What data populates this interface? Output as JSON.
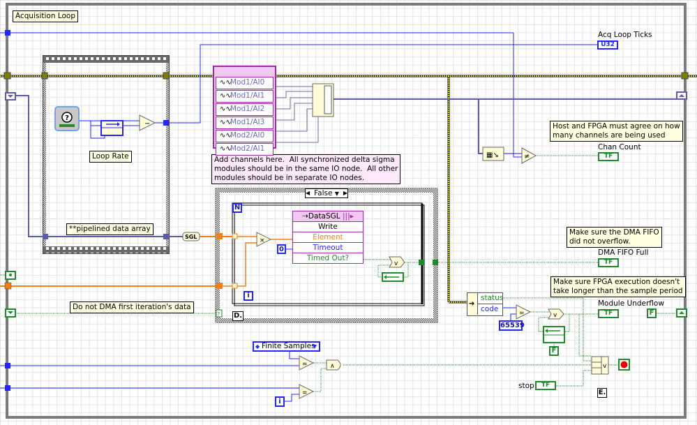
{
  "diagram_title": "Acquisition Loop",
  "comments": {
    "acquisition_loop": "Acquisition Loop",
    "loop_rate": "Loop Rate",
    "pipelined": "**pipelined data array",
    "add_channels": "Add channels here.  All synchronized delta sigma\nmodules should be in the same IO node.  All other\nmodules should be in separate IO nodes.",
    "do_not_dma": "Do not DMA first iteration's data",
    "host_fpga": "Host and FPGA must agree on how\nmany channels are being used",
    "dma_overflow": "Make sure the DMA FIFO\ndid not overflow.",
    "fpga_exec": "Make sure FPGA execution doesn't\ntake longer than the sample period"
  },
  "io_node": {
    "channels": [
      "Mod1/AI0",
      "Mod1/AI1",
      "Mod1/AI2",
      "Mod1/AI3",
      "Mod2/AI0",
      "Mod2/AI1"
    ]
  },
  "dma_node": {
    "fifo_name": "DataSGL",
    "method": "Write",
    "inputs": [
      "Element",
      "Timeout"
    ],
    "output": "Timed Out?",
    "colors": {
      "element": "#f07f1a",
      "timeout": "#2424ff",
      "timed_out": "#1f8a2a"
    }
  },
  "case_structure": {
    "selector_value": "False",
    "subdiagram_label": "D."
  },
  "for_loop": {
    "count_terminal": "N",
    "iteration_terminal": "i"
  },
  "constants": {
    "timeout": "0",
    "error_code": "65539",
    "false_const": "F",
    "false_const2": "F",
    "enum_value": "Finite Samples",
    "iteration_i": "i"
  },
  "conversion": "SGL",
  "indicators": {
    "acq_loop_ticks": {
      "label": "Acq Loop Ticks",
      "type": "U32"
    },
    "chan_count": {
      "label": "Chan Count",
      "type": "TF"
    },
    "dma_fifo_full": {
      "label": "DMA FIFO Full",
      "type": "TF"
    },
    "module_underflow": {
      "label": "Module Underflow",
      "type": "TF"
    }
  },
  "controls": {
    "stop": {
      "label": "stop",
      "type": "TF"
    }
  },
  "unbundle": {
    "fields": [
      "status",
      "code"
    ]
  },
  "subdiagram_label_E": "E.",
  "operators": {
    "subtract": "−",
    "multiply": "×",
    "not_equal": "≠",
    "equal": "=",
    "or": "v",
    "and": "∧"
  },
  "wire_colors": {
    "integer": "#2424ff",
    "array": "#5b5ba8",
    "float": "#f07f1a",
    "boolean": "#1f8a2a",
    "error": "#c8c800"
  }
}
